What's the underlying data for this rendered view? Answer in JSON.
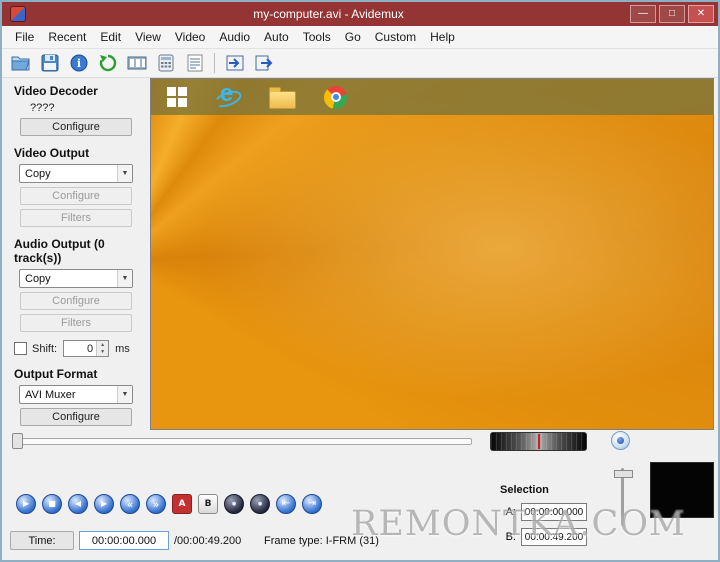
{
  "window": {
    "title": "my-computer.avi - Avidemux",
    "controls": {
      "minimize": "—",
      "maximize": "□",
      "close": "✕"
    }
  },
  "menu": {
    "items": [
      "File",
      "Recent",
      "Edit",
      "View",
      "Video",
      "Audio",
      "Auto",
      "Tools",
      "Go",
      "Custom",
      "Help"
    ]
  },
  "toolbar": {
    "icons": [
      "open-file",
      "save-file",
      "file-information",
      "reload",
      "save-video",
      "calculator",
      "job-list",
      "go-to-marker-a",
      "go-to-marker-b"
    ]
  },
  "sidebar": {
    "video_decoder": {
      "label": "Video Decoder",
      "value": "????",
      "configure": "Configure"
    },
    "video_output": {
      "label": "Video Output",
      "selected": "Copy",
      "configure": "Configure",
      "filters": "Filters"
    },
    "audio_output": {
      "label": "Audio Output (0 track(s))",
      "selected": "Copy",
      "configure": "Configure",
      "filters": "Filters",
      "shift_label": "Shift:",
      "shift_value": "0",
      "shift_unit": "ms"
    },
    "output_format": {
      "label": "Output Format",
      "selected": "AVI Muxer",
      "configure": "Configure"
    }
  },
  "transport": {
    "buttons": [
      {
        "name": "play",
        "glyph": "▶"
      },
      {
        "name": "stop",
        "glyph": "■"
      },
      {
        "name": "previous-frame",
        "glyph": "◀"
      },
      {
        "name": "next-frame",
        "glyph": "▶"
      },
      {
        "name": "previous-keyframe",
        "glyph": "«"
      },
      {
        "name": "next-keyframe",
        "glyph": "»"
      },
      {
        "name": "set-marker-a",
        "glyph": "A"
      },
      {
        "name": "set-marker-b",
        "glyph": "B"
      },
      {
        "name": "previous-black-frame",
        "glyph": "●"
      },
      {
        "name": "next-black-frame",
        "glyph": "●"
      },
      {
        "name": "first-frame",
        "glyph": "⇤"
      },
      {
        "name": "last-frame",
        "glyph": "⇥"
      }
    ]
  },
  "selection": {
    "title": "Selection",
    "a_label": "A:",
    "a_value": "00:00:00.000",
    "b_label": "B:",
    "b_value": "00:00:49.200"
  },
  "status": {
    "time_label": "Time:",
    "time_value": "00:00:00.000",
    "duration": "/00:00:49.200",
    "frame_type": "Frame type: I-FRM (31)"
  },
  "video_preview": {
    "taskbar_icons": [
      "windows-start",
      "internet-explorer",
      "file-explorer",
      "chrome"
    ]
  },
  "watermark": "REMONTKA.COM",
  "colors": {
    "titlebar": "#943434",
    "close_button": "#c75050",
    "desktop": "#ec9a12"
  }
}
